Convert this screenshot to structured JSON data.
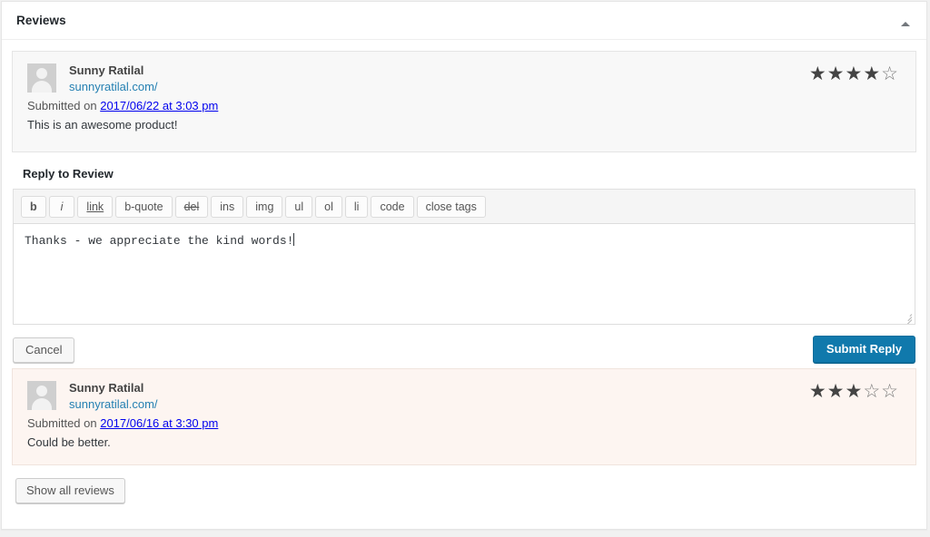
{
  "panel": {
    "title": "Reviews",
    "toggle_icon": "caret-up-icon"
  },
  "reviews": [
    {
      "author": "Sunny Ratilal",
      "site": "sunnyratilal.com/",
      "submitted_prefix": "Submitted on ",
      "date": "2017/06/22 at 3:03 pm",
      "text": "This is an awesome product!",
      "rating": 4,
      "max_rating": 5,
      "status": "approved",
      "stars_filled": "★★★★",
      "stars_empty": "☆"
    },
    {
      "author": "Sunny Ratilal",
      "site": "sunnyratilal.com/",
      "submitted_prefix": "Submitted on ",
      "date": "2017/06/16 at 3:30 pm",
      "text": "Could be better.",
      "rating": 3,
      "max_rating": 5,
      "status": "pending",
      "stars_filled": "★★★",
      "stars_empty": "☆☆"
    }
  ],
  "reply_form": {
    "label": "Reply to Review",
    "toolbar": [
      {
        "name": "bold",
        "label": "b"
      },
      {
        "name": "italic",
        "label": "i"
      },
      {
        "name": "link",
        "label": "link"
      },
      {
        "name": "blockquote",
        "label": "b-quote"
      },
      {
        "name": "del",
        "label": "del"
      },
      {
        "name": "ins",
        "label": "ins"
      },
      {
        "name": "img",
        "label": "img"
      },
      {
        "name": "ul",
        "label": "ul"
      },
      {
        "name": "ol",
        "label": "ol"
      },
      {
        "name": "li",
        "label": "li"
      },
      {
        "name": "code",
        "label": "code"
      },
      {
        "name": "close-tags",
        "label": "close tags"
      }
    ],
    "textarea_value": "Thanks - we appreciate the kind words!",
    "textarea_placeholder": "",
    "cancel_label": "Cancel",
    "submit_label": "Submit Reply"
  },
  "footer": {
    "show_all_label": "Show all reviews"
  },
  "colors": {
    "primary": "#1079ac",
    "link": "#2580b2",
    "approved_bg": "#f8f8f8",
    "pending_bg": "#fdf5f1",
    "star": "#444444"
  }
}
